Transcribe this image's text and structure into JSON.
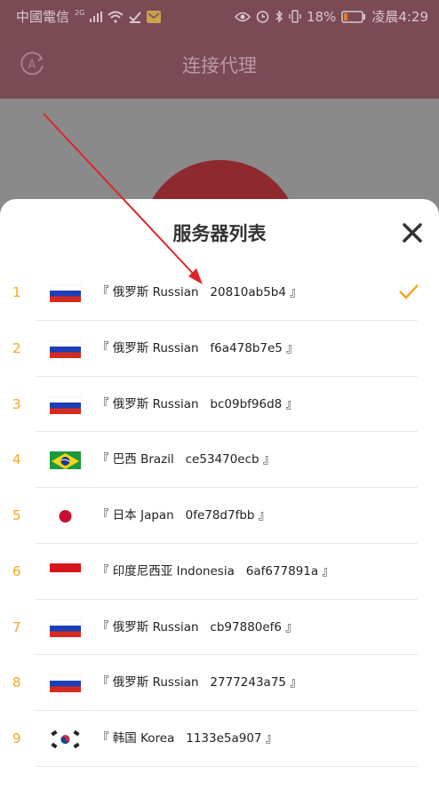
{
  "status_bar": {
    "carrier": "中國電信",
    "network": "2G",
    "battery": "18%",
    "time": "凌晨4:29"
  },
  "header": {
    "title": "连接代理"
  },
  "sheet": {
    "title": "服务器列表"
  },
  "servers": [
    {
      "index": "1",
      "label": "『 俄罗斯 Russian   20810ab5b4 』",
      "flag": "russia",
      "selected": true
    },
    {
      "index": "2",
      "label": "『 俄罗斯 Russian   f6a478b7e5 』",
      "flag": "russia",
      "selected": false
    },
    {
      "index": "3",
      "label": "『 俄罗斯 Russian   bc09bf96d8 』",
      "flag": "russia",
      "selected": false
    },
    {
      "index": "4",
      "label": "『 巴西 Brazil   ce53470ecb 』",
      "flag": "brazil",
      "selected": false
    },
    {
      "index": "5",
      "label": "『 日本 Japan   0fe78d7fbb 』",
      "flag": "japan",
      "selected": false
    },
    {
      "index": "6",
      "label": "『 印度尼西亚 Indonesia   6af677891a 』",
      "flag": "indonesia",
      "selected": false
    },
    {
      "index": "7",
      "label": "『 俄罗斯 Russian   cb97880ef6 』",
      "flag": "russia",
      "selected": false
    },
    {
      "index": "8",
      "label": "『 俄罗斯 Russian   2777243a75 』",
      "flag": "russia",
      "selected": false
    },
    {
      "index": "9",
      "label": "『 韩国 Korea   1133e5a907 』",
      "flag": "korea",
      "selected": false
    }
  ],
  "colors": {
    "accent": "#f5a623",
    "header_bg": "#7b4a55",
    "arrow": "#e02424"
  }
}
